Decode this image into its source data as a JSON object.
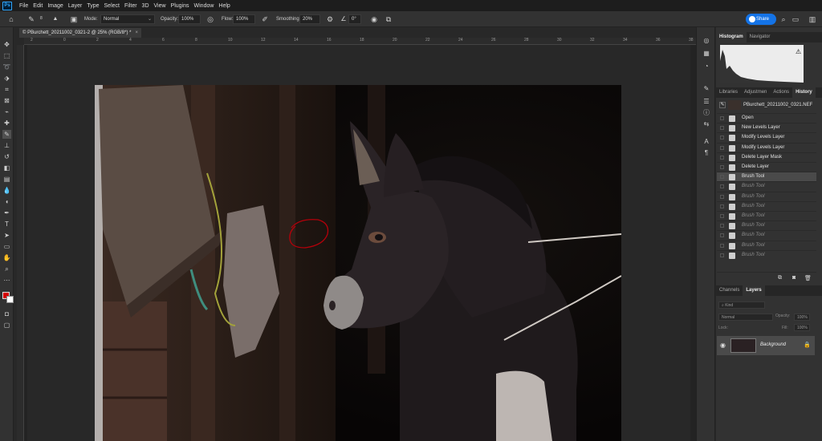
{
  "menu": {
    "logo": "Ps",
    "items": [
      "File",
      "Edit",
      "Image",
      "Layer",
      "Type",
      "Select",
      "Filter",
      "3D",
      "View",
      "Plugins",
      "Window",
      "Help"
    ]
  },
  "options": {
    "brush_size": "8",
    "mode_label": "Mode:",
    "mode_value": "Normal",
    "opacity_label": "Opacity:",
    "opacity_value": "100%",
    "flow_label": "Flow:",
    "flow_value": "100%",
    "smoothing_label": "Smoothing:",
    "smoothing_value": "20%",
    "angle_value": "0°",
    "share_label": "Share"
  },
  "document": {
    "tab_title": "© PBurchett_20211002_0321-2 @ 25% (RGB/8*) *",
    "close": "×"
  },
  "rulers": {
    "top": [
      "2",
      "0",
      "2",
      "4",
      "6",
      "8",
      "10",
      "12",
      "14",
      "16",
      "18",
      "20",
      "22",
      "24",
      "26",
      "28",
      "30",
      "32",
      "34",
      "36",
      "38"
    ]
  },
  "panels": {
    "top_tabs": [
      "Histogram",
      "Navigator"
    ],
    "mid_tabs": [
      "Libraries",
      "Adjustmen",
      "Actions",
      "History"
    ],
    "history_snapshot": "PBurchett_20211002_0321.NEF",
    "history": [
      {
        "label": "Open",
        "state": "normal"
      },
      {
        "label": "New Levels Layer",
        "state": "normal"
      },
      {
        "label": "Modify Levels Layer",
        "state": "normal"
      },
      {
        "label": "Modify Levels Layer",
        "state": "normal"
      },
      {
        "label": "Delete Layer Mask",
        "state": "normal"
      },
      {
        "label": "Delete Layer",
        "state": "normal"
      },
      {
        "label": "Brush Tool",
        "state": "selected"
      },
      {
        "label": "Brush Tool",
        "state": "dim"
      },
      {
        "label": "Brush Tool",
        "state": "dim"
      },
      {
        "label": "Brush Tool",
        "state": "dim"
      },
      {
        "label": "Brush Tool",
        "state": "dim"
      },
      {
        "label": "Brush Tool",
        "state": "dim"
      },
      {
        "label": "Brush Tool",
        "state": "dim"
      },
      {
        "label": "Brush Tool",
        "state": "dim"
      },
      {
        "label": "Brush Tool",
        "state": "dim"
      }
    ],
    "bottom_tabs": [
      "Channels",
      "Layers"
    ],
    "layers": {
      "kind": "Kind",
      "blend": "Normal",
      "opacity_label": "Opacity:",
      "opacity_value": "100%",
      "lock_label": "Lock:",
      "fill_label": "Fill:",
      "fill_value": "100%",
      "layer_name": "Background"
    }
  },
  "colors": {
    "accent": "#1473e6",
    "foreground": "#d40000",
    "background": "#ffffff"
  }
}
